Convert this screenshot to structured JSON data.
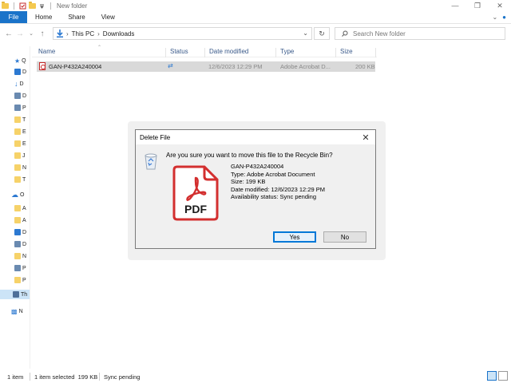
{
  "window": {
    "title": "New folder"
  },
  "ribbon": {
    "tabs": [
      {
        "label": "File"
      },
      {
        "label": "Home"
      },
      {
        "label": "Share"
      },
      {
        "label": "View"
      }
    ]
  },
  "address": {
    "crumbs": [
      "This PC",
      "Downloads"
    ],
    "search_placeholder": "Search New folder"
  },
  "navpane": {
    "items": [
      {
        "label": "Q",
        "icon": "star-icon"
      },
      {
        "label": "D",
        "icon": "desktop-icon"
      },
      {
        "label": "D",
        "icon": "download-icon"
      },
      {
        "label": "D",
        "icon": "documents-icon"
      },
      {
        "label": "P",
        "icon": "pictures-icon"
      },
      {
        "label": "T",
        "icon": "folder-icon"
      },
      {
        "label": "E",
        "icon": "folder-icon"
      },
      {
        "label": "E",
        "icon": "folder-icon"
      },
      {
        "label": "J",
        "icon": "folder-icon"
      },
      {
        "label": "N",
        "icon": "folder-icon"
      },
      {
        "label": "T",
        "icon": "folder-icon"
      },
      {
        "label": "O",
        "icon": "onedrive-icon"
      },
      {
        "label": "A",
        "icon": "folder-icon"
      },
      {
        "label": "A",
        "icon": "folder-icon"
      },
      {
        "label": "D",
        "icon": "desktop-icon"
      },
      {
        "label": "D",
        "icon": "documents-icon"
      },
      {
        "label": "N",
        "icon": "folder-icon"
      },
      {
        "label": "P",
        "icon": "pictures-icon"
      },
      {
        "label": "P",
        "icon": "folder-icon"
      },
      {
        "label": "Th",
        "icon": "pc-icon"
      },
      {
        "label": "N",
        "icon": "network-icon"
      }
    ]
  },
  "list": {
    "columns": [
      "Name",
      "Status",
      "Date modified",
      "Type",
      "Size"
    ],
    "rows": [
      {
        "name": "GAN-P432A240004",
        "date": "12/6/2023 12:29 PM",
        "type": "Adobe Acrobat D...",
        "size": "200 KB"
      }
    ]
  },
  "statusbar": {
    "count": "1 item",
    "selected": "1 item selected  199 KB",
    "sync": "Sync pending"
  },
  "dialog": {
    "title": "Delete File",
    "question": "Are you sure you want to move this file to the Recycle Bin?",
    "file_name": "GAN-P432A240004",
    "type_line": "Type: Adobe Acrobat Document",
    "size_line": "Size: 199 KB",
    "date_line": "Date modified: 12/6/2023 12:29 PM",
    "avail_line": "Availability status: Sync pending",
    "pdf_label": "PDF",
    "yes_label": "Yes",
    "no_label": "No"
  },
  "colors": {
    "accent": "#1a73c9",
    "pdf_red": "#d32f2f"
  }
}
